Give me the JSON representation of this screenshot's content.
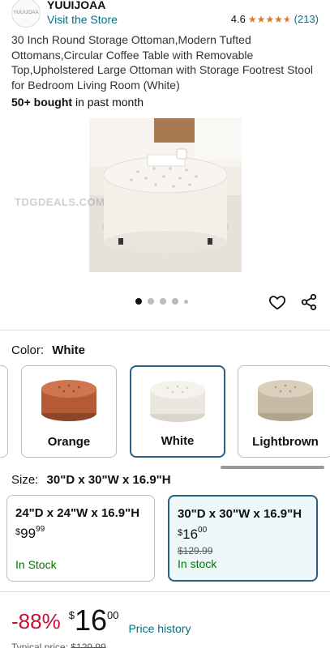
{
  "store": {
    "logo_text": "YUUIJOAA",
    "brand": "YUUIJOAA",
    "visit_link": "Visit the Store",
    "rating": "4.6",
    "review_count": "(213)"
  },
  "product": {
    "title": "30 Inch Round Storage Ottoman,Modern Tufted Ottomans,Circular Coffee Table with Removable Top,Upholstered Large Ottoman with Storage Footrest Stool for Bedroom Living Room (White)",
    "bought_bold": "50+ bought",
    "bought_rest": "in past month",
    "watermark": "TDGDEALS.COM",
    "image_count": 5,
    "active_image": 1
  },
  "color": {
    "label": "Color:",
    "selected": "White",
    "options": [
      {
        "name": "Orange",
        "fill": "#c0643e",
        "selected": false
      },
      {
        "name": "White",
        "fill": "#efebe4",
        "selected": true
      },
      {
        "name": "Lightbrown",
        "fill": "#cdbfaa",
        "selected": false
      }
    ]
  },
  "size": {
    "label": "Size:",
    "selected": "30\"D x 30\"W x 16.9\"H",
    "options": [
      {
        "size": "24\"D x 24\"W x 16.9\"H",
        "price_whole": "99",
        "price_frac": "99",
        "list_price": "",
        "stock": "In Stock",
        "selected": false
      },
      {
        "size": "30\"D x 30\"W x 16.9\"H",
        "price_whole": "16",
        "price_frac": "00",
        "list_price": "$129.99",
        "stock": "In stock",
        "selected": true
      }
    ]
  },
  "pricing": {
    "discount": "-88%",
    "currency": "$",
    "whole": "16",
    "fraction": "00",
    "price_history": "Price history",
    "typical_label": "Typical price:",
    "typical_price": "$129.99"
  },
  "colors": {
    "link": "#007185",
    "accent_border": "#2a6081",
    "discount": "#cc0c39",
    "star": "#de7921",
    "in_stock": "#007600"
  }
}
